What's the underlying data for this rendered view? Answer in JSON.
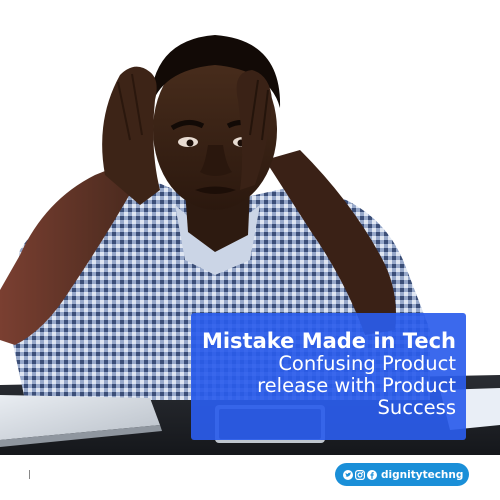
{
  "caption": {
    "title": "Mistake Made in Tech",
    "subtitle": "Confusing Product\nrelease with Product\nSuccess"
  },
  "brand": {
    "handle": "dignitytechng",
    "icons": [
      "twitter-icon",
      "instagram-icon",
      "facebook-icon"
    ],
    "color": "#1a8fd8"
  },
  "colors": {
    "caption_bg": "#2a5ceb",
    "shirt": "#6f86b0",
    "skin": "#3b2416"
  }
}
